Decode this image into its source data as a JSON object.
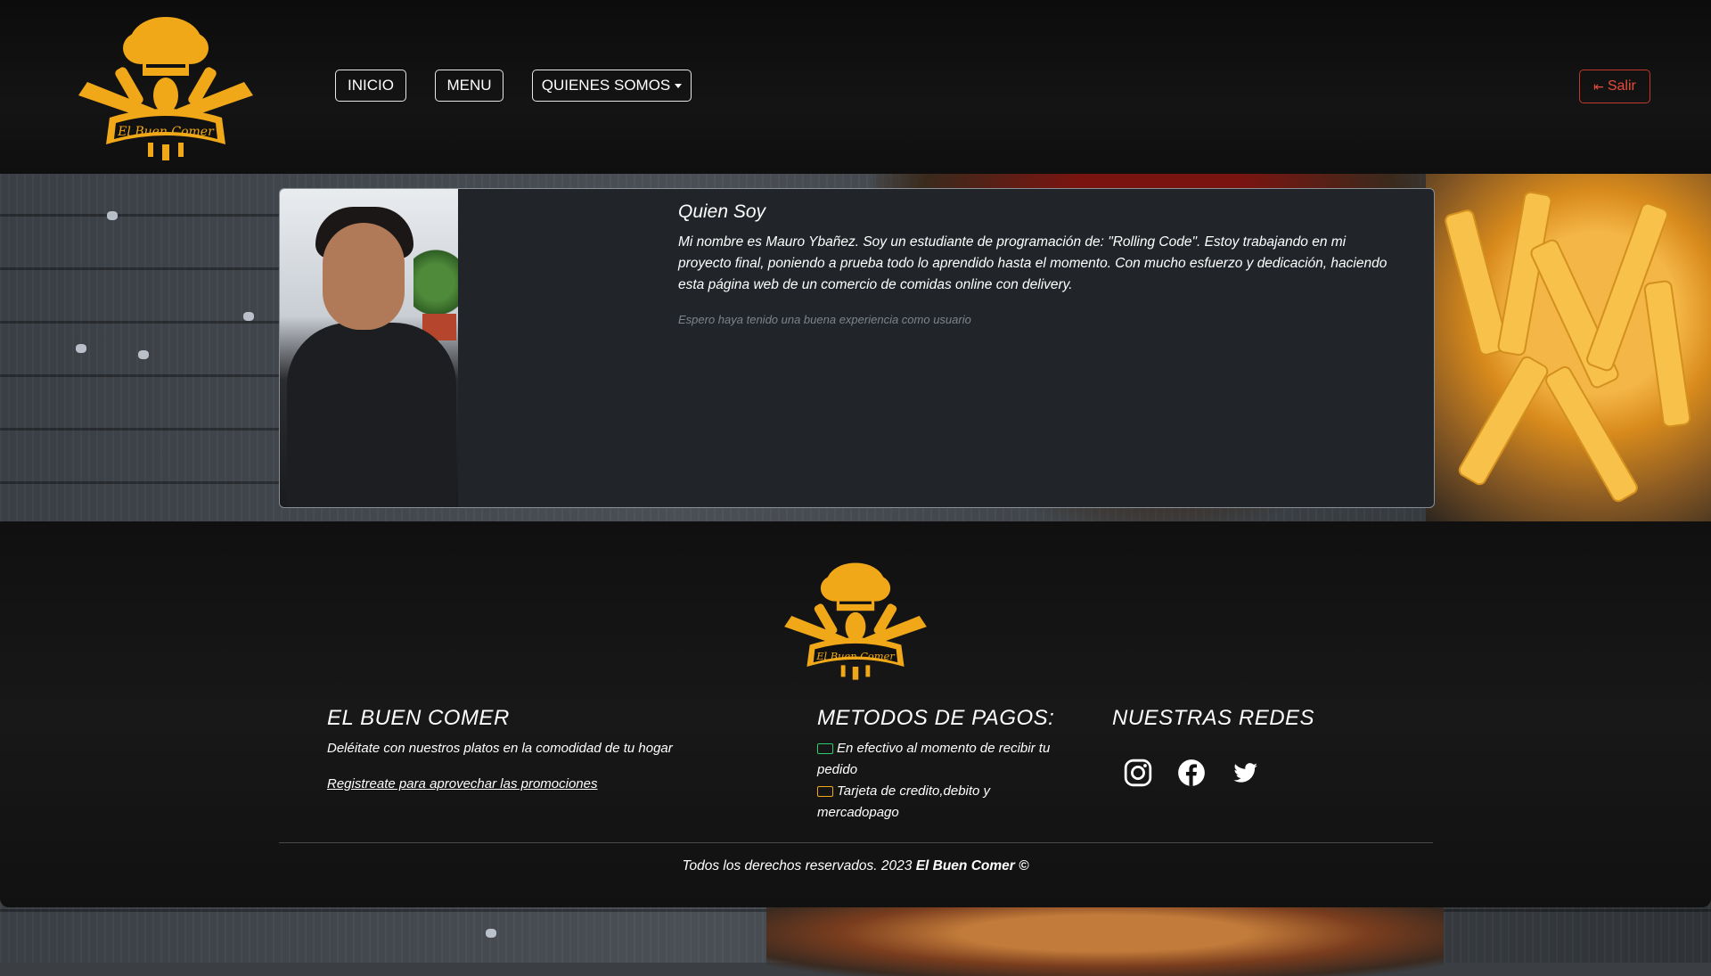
{
  "brand": {
    "name": "El Buen Comer",
    "logo_text": "El Buen Comer",
    "accent": "#f0a818"
  },
  "nav": {
    "items": [
      {
        "label": "INICIO"
      },
      {
        "label": "MENU"
      },
      {
        "label": "QUIENES SOMOS"
      }
    ],
    "logout_label": "Salir",
    "logout_color": "#e74c3c"
  },
  "card": {
    "title": "Quien Soy",
    "text": "Mi nombre es Mauro Ybañez. Soy un estudiante de programación de: \"Rolling Code\". Estoy trabajando en mi proyecto final, poniendo a prueba todo lo aprendido hasta el momento. Con mucho esfuerzo y dedicación, haciendo esta página web de un comercio de comidas online con delivery.",
    "muted": "Espero haya tenido una buena experiencia como usuario"
  },
  "footer": {
    "col1": {
      "title": "EL BUEN COMER",
      "tagline": "Deléitate con nuestros platos en la comodidad de tu hogar",
      "link": "Registreate para aprovechar las promociones"
    },
    "col2": {
      "title": "METODOS DE PAGOS:",
      "item1": "En efectivo al momento de recibir tu pedido",
      "item2": "Tarjeta de credito,debito y mercadopago"
    },
    "col3": {
      "title": "NUESTRAS REDES",
      "icons": [
        "instagram-icon",
        "facebook-icon",
        "twitter-icon"
      ]
    },
    "copyright_prefix": "Todos los derechos reservados. 2023 ",
    "copyright_brand": "El Buen Comer ©"
  }
}
